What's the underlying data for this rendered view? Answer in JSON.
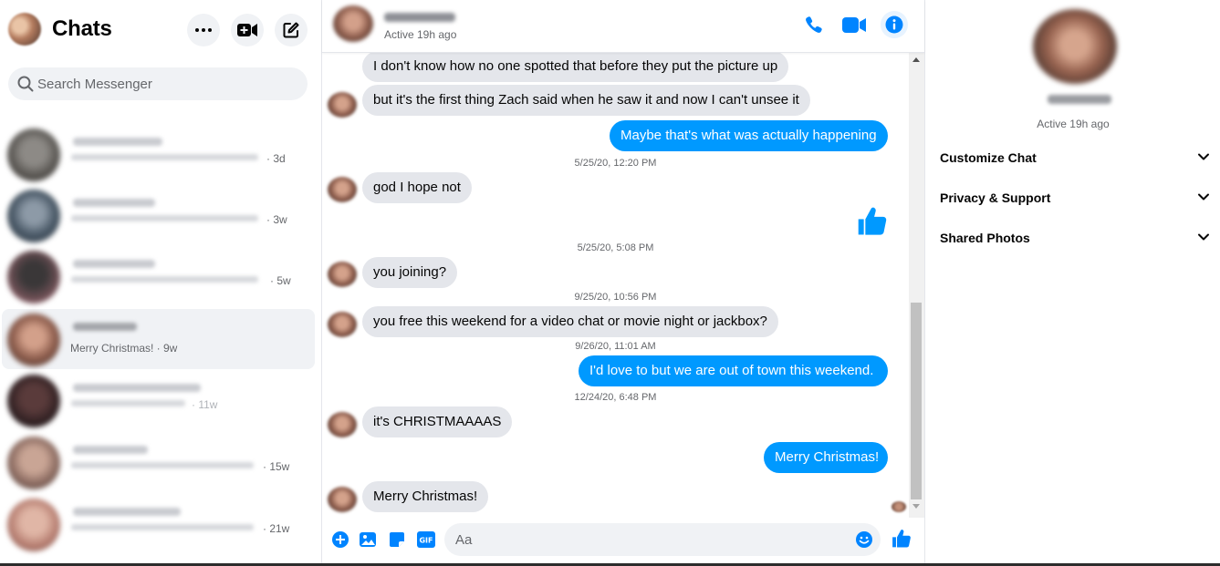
{
  "sidebar": {
    "title": "Chats",
    "search_placeholder": "Search Messenger",
    "conversations": [
      {
        "time": "· 3d"
      },
      {
        "time": "· 3w"
      },
      {
        "time": "· 5w"
      },
      {
        "preview": "Merry Christmas! · 9w"
      },
      {
        "time": "· 11w"
      },
      {
        "time": "· 15w"
      },
      {
        "time": "· 21w"
      }
    ]
  },
  "chat": {
    "status": "Active 19h ago",
    "messages": [
      {
        "from": "them",
        "text": "I don't know how no one spotted that before they put the picture up"
      },
      {
        "from": "them",
        "text": "but it's the first thing Zach said when he saw it and now I can't unsee it"
      },
      {
        "from": "me",
        "text": "Maybe that's what was actually happening"
      },
      {
        "from": "them",
        "text": "god I hope not"
      },
      {
        "from": "them",
        "text": "you joining?"
      },
      {
        "from": "them",
        "text": "you free this weekend for a video chat or movie night or jackbox?"
      },
      {
        "from": "me",
        "text": "I'd love to but we are out of town this weekend."
      },
      {
        "from": "them",
        "text": "it's CHRISTMAAAAS"
      },
      {
        "from": "me",
        "text": "Merry Christmas!"
      },
      {
        "from": "them",
        "text": "Merry Christmas!"
      }
    ],
    "timestamps": [
      "5/25/20, 12:20 PM",
      "5/25/20, 5:08 PM",
      "9/25/20, 10:56 PM",
      "9/26/20, 11:01 AM",
      "12/24/20, 6:48 PM"
    ],
    "input_placeholder": "Aa"
  },
  "details": {
    "status": "Active 19h ago",
    "sections": [
      "Customize Chat",
      "Privacy & Support",
      "Shared Photos"
    ]
  },
  "colors": {
    "accent": "#0099ff",
    "bubble_in": "#e4e6eb",
    "icon_blue": "#0084ff"
  },
  "icons": [
    "more-icon",
    "new-video-call-icon",
    "compose-icon",
    "search-icon",
    "phone-icon",
    "video-icon",
    "info-icon",
    "plus-icon",
    "image-icon",
    "sticker-icon",
    "gif-icon",
    "emoji-icon",
    "thumbs-up-icon",
    "chevron-down-icon"
  ]
}
